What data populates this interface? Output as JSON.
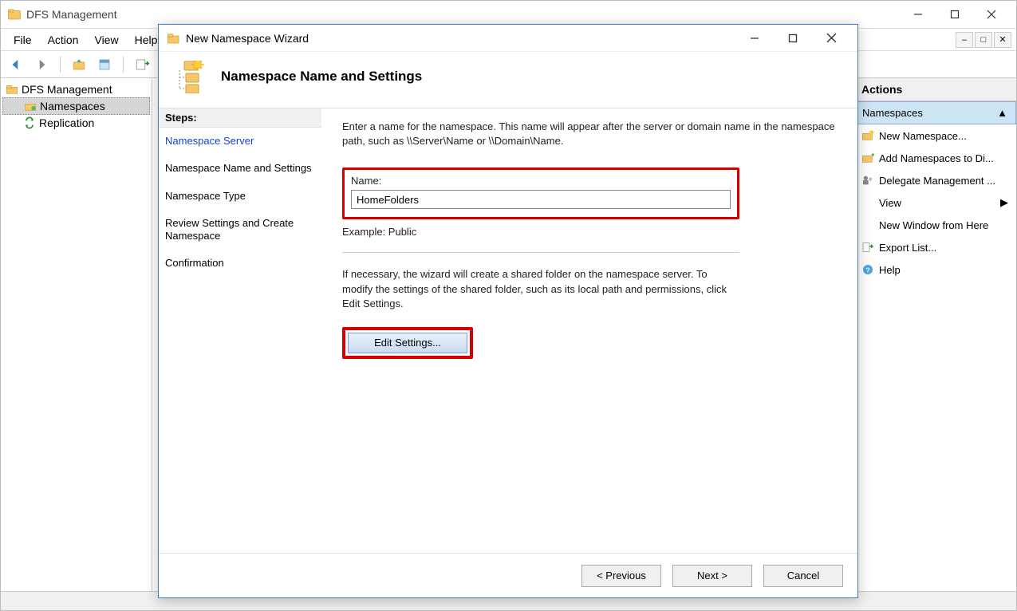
{
  "main_window": {
    "title": "DFS Management",
    "menus": {
      "file": "File",
      "action": "Action",
      "view": "View",
      "help": "Help"
    }
  },
  "tree": {
    "root": "DFS Management",
    "children": {
      "namespaces": "Namespaces",
      "replication": "Replication"
    }
  },
  "actions_panel": {
    "header": "Actions",
    "group": "Namespaces",
    "items": {
      "new_namespace": "New Namespace...",
      "add_namespaces": "Add Namespaces to Di...",
      "delegate": "Delegate Management ...",
      "view": "View",
      "new_window": "New Window from Here",
      "export": "Export List...",
      "help": "Help"
    }
  },
  "dialog": {
    "title": "New Namespace Wizard",
    "header": "Namespace Name and Settings",
    "steps_label": "Steps:",
    "steps": {
      "server": "Namespace Server",
      "name": "Namespace Name and Settings",
      "type": "Namespace Type",
      "review": "Review Settings and Create Namespace",
      "confirm": "Confirmation"
    },
    "desc": "Enter a name for the namespace. This name will appear after the server or domain name in the namespace path, such as \\\\Server\\Name or \\\\Domain\\Name.",
    "name_label": "Name:",
    "name_value": "HomeFolders",
    "example": "Example: Public",
    "note": "If necessary, the wizard will create a shared folder on the namespace server. To modify the settings of the shared folder, such as its local path and permissions, click Edit Settings.",
    "edit_settings": "Edit Settings...",
    "buttons": {
      "previous": "< Previous",
      "next": "Next >",
      "cancel": "Cancel"
    }
  }
}
